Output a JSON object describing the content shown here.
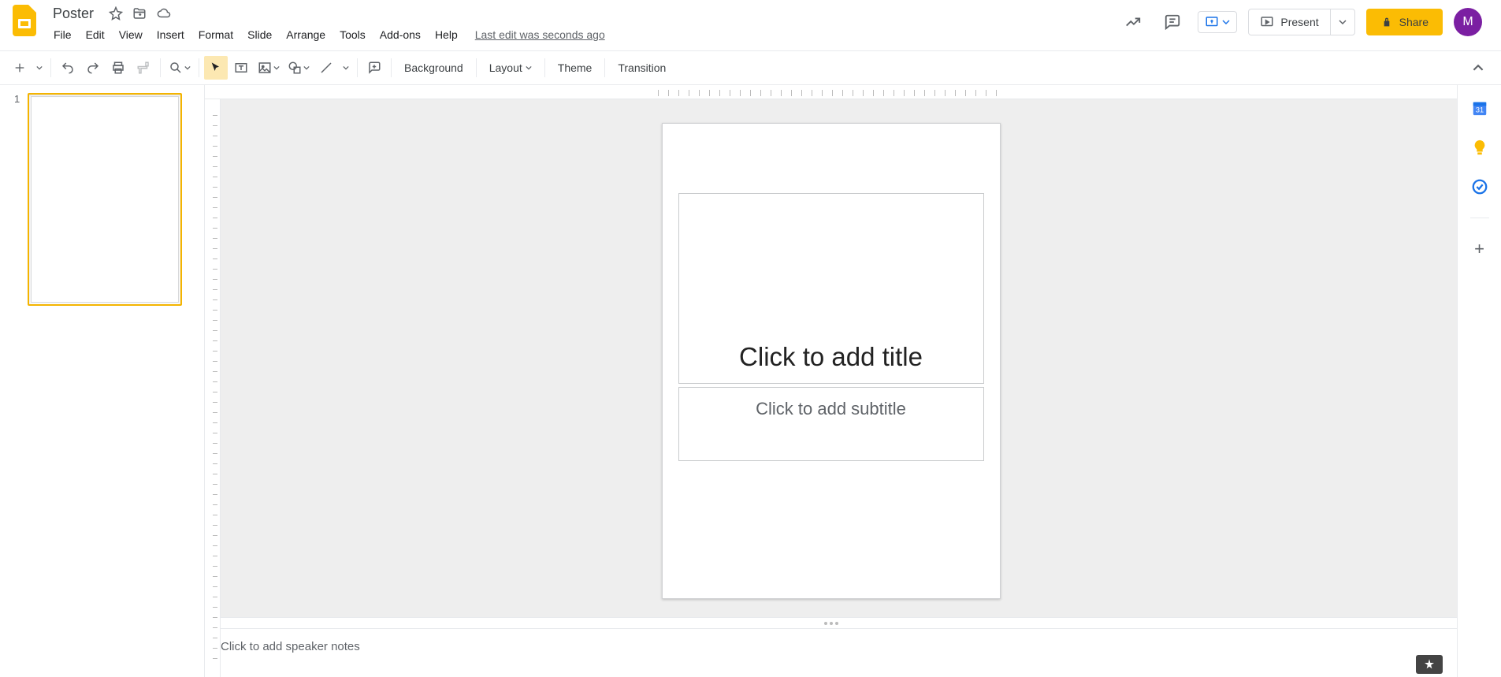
{
  "header": {
    "doc_title": "Poster",
    "last_edit": "Last edit was seconds ago",
    "present_label": "Present",
    "share_label": "Share",
    "avatar_letter": "M"
  },
  "menu": {
    "items": [
      "File",
      "Edit",
      "View",
      "Insert",
      "Format",
      "Slide",
      "Arrange",
      "Tools",
      "Add-ons",
      "Help"
    ]
  },
  "toolbar": {
    "background": "Background",
    "layout": "Layout",
    "theme": "Theme",
    "transition": "Transition"
  },
  "filmstrip": {
    "slides": [
      {
        "number": "1"
      }
    ]
  },
  "slide": {
    "title_placeholder": "Click to add title",
    "subtitle_placeholder": "Click to add subtitle"
  },
  "notes": {
    "placeholder": "Click to add speaker notes"
  }
}
